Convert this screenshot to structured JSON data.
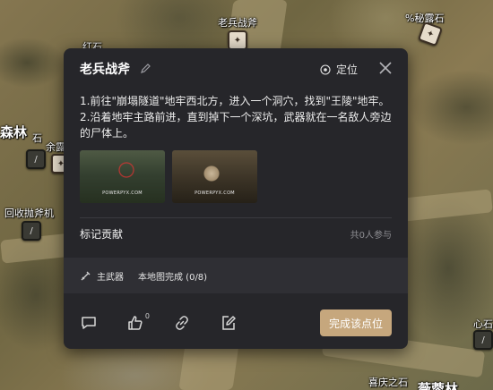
{
  "map": {
    "labels": [
      {
        "id": "top-weapon",
        "text": "老兵战斧"
      },
      {
        "id": "top-right",
        "text": "%秘露石"
      },
      {
        "id": "red-stone",
        "text": "红石"
      },
      {
        "id": "forest",
        "text": "森林"
      },
      {
        "id": "stone-left",
        "text": "石"
      },
      {
        "id": "yu",
        "text": "余露"
      },
      {
        "id": "reclaim-axe",
        "text": "回收抛斧机"
      },
      {
        "id": "heart-stone",
        "text": "心石"
      },
      {
        "id": "joy-stone",
        "text": "喜庆之石"
      },
      {
        "id": "bottom-right",
        "text": "薇蓉林"
      }
    ]
  },
  "panel": {
    "title": "老兵战斧",
    "locate_label": "定位",
    "description": [
      "1.前往\"崩塌隧道\"地牢西北方，进入一个洞穴，找到\"王陵\"地牢。",
      "2.沿着地牢主路前进，直到掉下一个深坑，武器就在一名敌人旁边的尸体上。"
    ],
    "thumbnails": [
      {
        "watermark": "POWERPYX.COM"
      },
      {
        "watermark": "POWERPYX.COM"
      }
    ],
    "contrib_title": "标记贡献",
    "contrib_count": "共0人参与",
    "weapon_category": "主武器",
    "map_complete": "本地图完成 (0/8)",
    "like_count": "0",
    "complete_button": "完成该点位"
  }
}
